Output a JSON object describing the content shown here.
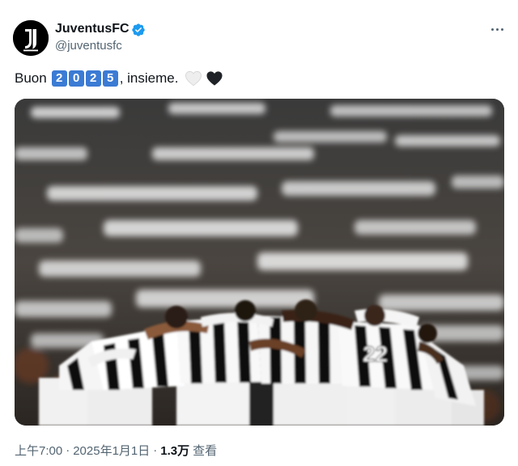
{
  "account": {
    "display_name": "JuventusFC",
    "handle": "@juventusfc",
    "verified": true,
    "avatar_icon": "juventus-logo-icon",
    "verified_icon": "verified-badge-icon",
    "verified_color": "#1d9bf0"
  },
  "menu": {
    "icon": "more-options-icon"
  },
  "tweet": {
    "text_before": "Buon",
    "year_digits": [
      "2",
      "0",
      "2",
      "5"
    ],
    "text_after": ", insieme.",
    "emojis": [
      "white-heart-icon",
      "black-heart-icon"
    ],
    "digit_key_color": "#3b7bd4"
  },
  "media": {
    "type": "photo",
    "subject": "team-huddle-photo"
  },
  "footer": {
    "time": "上午7:00",
    "separator1": "·",
    "date": "2025年1月1日",
    "separator2": "·",
    "views_count": "1.3万",
    "views_label": "查看"
  }
}
